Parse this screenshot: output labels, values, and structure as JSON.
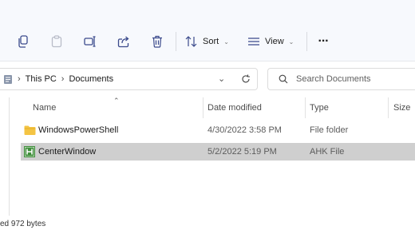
{
  "toolbar": {
    "sort_label": "Sort",
    "view_label": "View",
    "more_label": "···"
  },
  "address": {
    "crumbs": [
      "This PC",
      "Documents"
    ]
  },
  "search": {
    "placeholder": "Search Documents"
  },
  "columns": {
    "name": "Name",
    "date": "Date modified",
    "type": "Type",
    "size": "Size"
  },
  "files": [
    {
      "name": "WindowsPowerShell",
      "date": "4/30/2022 3:58 PM",
      "type": "File folder",
      "icon": "folder-icon",
      "selected": false
    },
    {
      "name": "CenterWindow",
      "date": "5/2/2022 5:19 PM",
      "type": "AHK File",
      "icon": "ahk-file-icon",
      "selected": true
    }
  ],
  "status": {
    "text": "ed  972 bytes"
  },
  "colors": {
    "folder": "#f4c443",
    "ahk": "#3f8f3a",
    "selection": "#cfcfcf"
  }
}
